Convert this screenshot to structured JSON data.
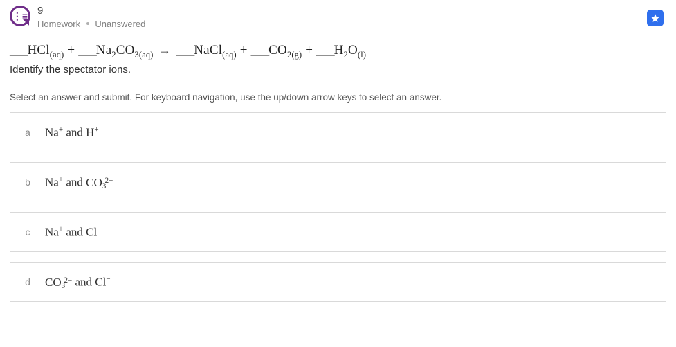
{
  "header": {
    "question_number": "9",
    "category": "Homework",
    "status": "Unanswered"
  },
  "equation_html": "<span class='blank'>___</span>HCl<sub class='state'>(aq)</sub> + <span class='blank'>___</span>Na<sub>2</sub>CO<sub>3</sub><sub class='state'>(aq)</sub> <span class='arrow'>→</span> <span class='blank'>___</span>NaCl<sub class='state'>(aq)</sub> + <span class='blank'>___</span>CO<sub>2</sub><sub class='state'>(g)</sub> + <span class='blank'>___</span>H<sub>2</sub>O<sub class='state'>(l)</sub>",
  "prompt": "Identify the spectator ions.",
  "instructions": "Select an answer and submit. For keyboard navigation, use the up/down arrow keys to select an answer.",
  "options": [
    {
      "key": "a",
      "html": "Na<sup>+</sup> and H<sup>+</sup>"
    },
    {
      "key": "b",
      "html": "Na<sup>+</sup> and <span class='co3'>CO<span class='sb'>3</span><span class='sp'>2−</span></span>"
    },
    {
      "key": "c",
      "html": "Na<sup>+</sup> and Cl<sup>−</sup>"
    },
    {
      "key": "d",
      "html": "<span class='co3'>CO<span class='sb'>3</span><span class='sp'>2−</span></span> and Cl<sup>−</sup>"
    }
  ]
}
